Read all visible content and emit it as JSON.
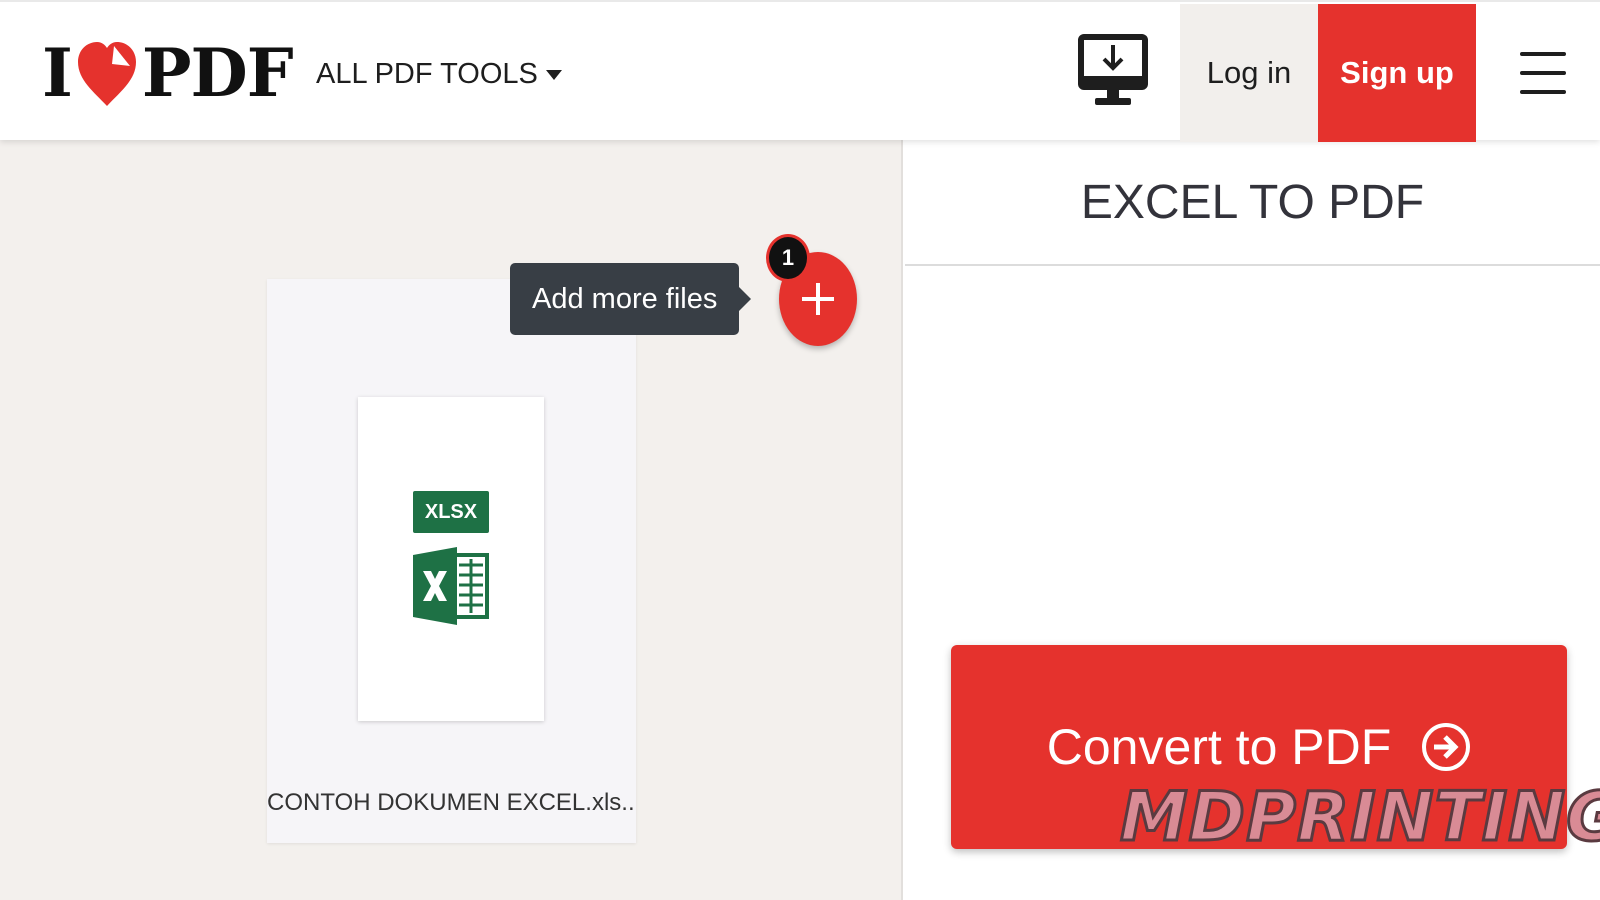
{
  "header": {
    "logo": {
      "part1": "I",
      "part2": "PDF",
      "heart_color": "#e5322d"
    },
    "tools_menu_label": "ALL PDF TOOLS",
    "desktop_icon": "desktop-download-icon",
    "login_label": "Log in",
    "signup_label": "Sign up",
    "menu_icon": "hamburger-icon"
  },
  "workspace": {
    "file": {
      "badge": "XLSX",
      "name": "CONTOH DOKUMEN EXCEL.xls..."
    },
    "tooltip": "Add more files",
    "add_button": "+",
    "file_count": "1"
  },
  "sidebar": {
    "title": "EXCEL TO PDF",
    "convert_label": "Convert to PDF"
  },
  "watermark": "MDPRINTING",
  "colors": {
    "accent": "#e5322d",
    "excel_green": "#1e7145",
    "tooltip_bg": "#383e45"
  }
}
